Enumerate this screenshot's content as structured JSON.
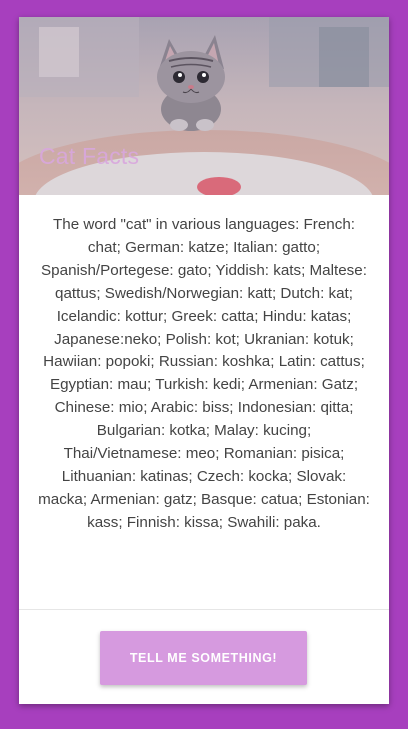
{
  "header": {
    "title": "Cat Facts"
  },
  "fact": {
    "text": "The word \"cat\" in various languages: French: chat; German: katze; Italian: gatto; Spanish/Portegese: gato; Yiddish: kats; Maltese: qattus; Swedish/Norwegian: katt; Dutch: kat; Icelandic: kottur; Greek: catta; Hindu: katas; Japanese:neko; Polish: kot; Ukranian: kotuk; Hawiian: popoki; Russian: koshka; Latin: cattus; Egyptian: mau; Turkish: kedi; Armenian: Gatz; Chinese: mio; Arabic: biss; Indonesian: qitta; Bulgarian: kotka; Malay: kucing; Thai/Vietnamese: meo; Romanian: pisica; Lithuanian: katinas; Czech: kocka; Slovak: macka; Armenian: gatz; Basque: catua; Estonian: kass; Finnish: kissa; Swahili: paka."
  },
  "actions": {
    "button_label": "TELL ME SOMETHING!"
  },
  "colors": {
    "background": "#a73fbe",
    "button": "#d69adf",
    "title": "#d9a7de"
  }
}
